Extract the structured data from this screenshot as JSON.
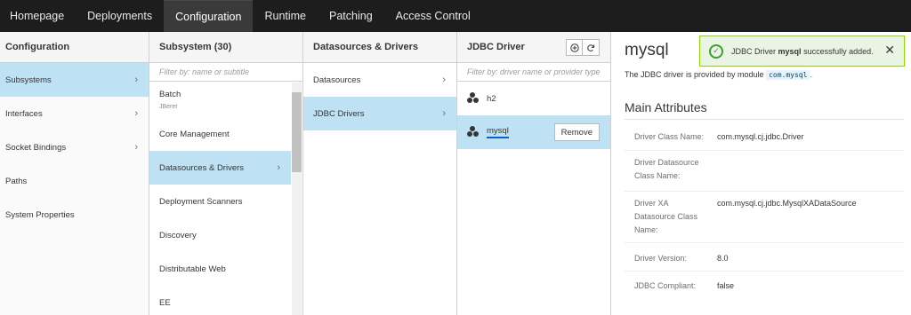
{
  "nav": {
    "tabs": [
      "Homepage",
      "Deployments",
      "Configuration",
      "Runtime",
      "Patching",
      "Access Control"
    ],
    "active": "Configuration"
  },
  "col1": {
    "title": "Configuration",
    "items": [
      "Subsystems",
      "Interfaces",
      "Socket Bindings",
      "Paths",
      "System Properties"
    ]
  },
  "col2": {
    "title": "Subsystem (30)",
    "filter_placeholder": "Filter by: name or subtitle",
    "items": [
      {
        "label": "Batch",
        "sub": "JBeret"
      },
      {
        "label": "Core Management"
      },
      {
        "label": "Datasources & Drivers"
      },
      {
        "label": "Deployment Scanners"
      },
      {
        "label": "Discovery"
      },
      {
        "label": "Distributable Web"
      },
      {
        "label": "EE"
      }
    ]
  },
  "col3": {
    "title": "Datasources & Drivers",
    "items": [
      "Datasources",
      "JDBC Drivers"
    ]
  },
  "col4": {
    "title": "JDBC Driver",
    "add_icon": "plus-circle-icon",
    "refresh_icon": "refresh-icon",
    "filter_placeholder": "Filter by: driver name or provider type",
    "items": [
      "h2",
      "mysql"
    ],
    "remove_label": "Remove"
  },
  "detail": {
    "title": "mysql",
    "desc_prefix": "The JDBC driver is provided by module",
    "module": "com.mysql",
    "desc_suffix": ".",
    "section": "Main Attributes",
    "attributes": [
      {
        "key": "Driver Class Name:",
        "value": "com.mysql.cj.jdbc.Driver"
      },
      {
        "key": "Driver Datasource Class Name:",
        "value": ""
      },
      {
        "key": "Driver XA Datasource Class Name:",
        "value": "com.mysql.cj.jdbc.MysqlXADataSource"
      },
      {
        "key": "Driver Version:",
        "value": "8.0"
      },
      {
        "key": "JDBC Compliant:",
        "value": "false"
      }
    ]
  },
  "toast": {
    "prefix": "JDBC Driver",
    "bold": "mysql",
    "suffix": "successfully added.",
    "close": "✕",
    "check": "✓"
  },
  "colors": {
    "accent": "#0066cc",
    "selected": "#bee1f4",
    "success": "#3f9c35"
  }
}
